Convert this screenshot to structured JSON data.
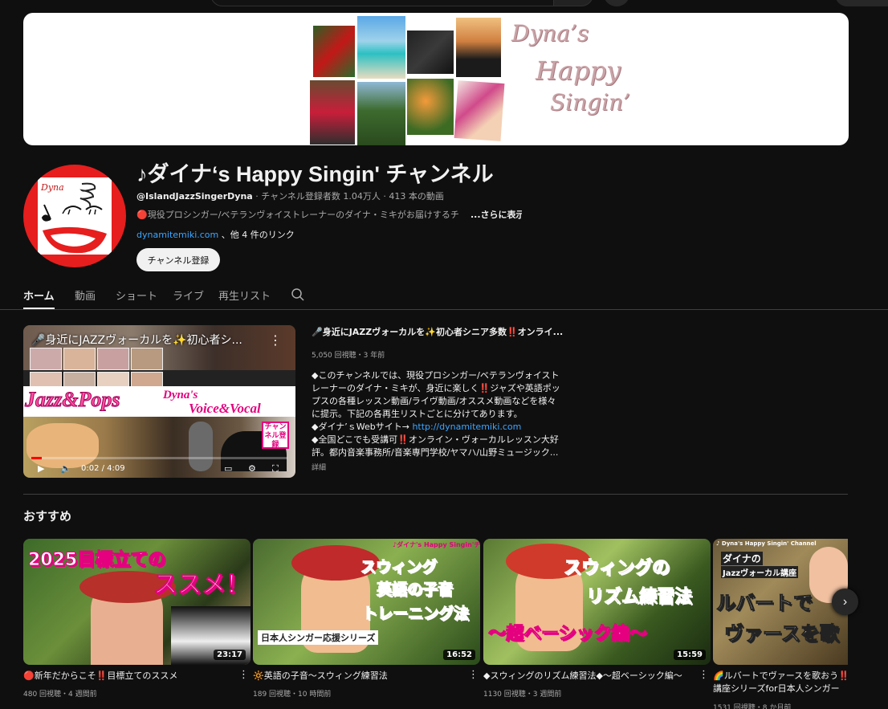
{
  "channel": {
    "title": "♪ダイナ‘s Happy Singin' チャンネル",
    "handle": "@IslandJazzSingerDyna",
    "stats": " · チャンネル登録者数 1.04万人 · 413 本の動画",
    "description": "🔴現役プロシンガー/ベテランヴォイストレーナーのダイナ・ミキがお届けするチ",
    "more_label": "...さらに表示",
    "link_text": "dynamitemiki.com",
    "link_suffix": " 、他 4 件のリンク",
    "subscribe_label": "チャンネル登録",
    "banner_title": [
      "Dyna’s",
      "Happy",
      "Singin’"
    ],
    "avatar_text": "Dyna"
  },
  "tabs": [
    {
      "label": "ホーム",
      "active": true
    },
    {
      "label": "動画",
      "active": false
    },
    {
      "label": "ショート",
      "active": false
    },
    {
      "label": "ライブ",
      "active": false
    },
    {
      "label": "再生リスト",
      "active": false
    }
  ],
  "featured": {
    "overlay_title": "🎤身近にJAZZヴォーカルを✨初心者シ...",
    "title": "🎤身近にJAZZヴォーカルを✨初心者シニア多数‼️オンライ...",
    "meta": "5,050 回視聴・3 年前",
    "desc_lines": [
      "◆このチャンネルでは、現役プロシンガー/ベテランヴォイスト",
      "レーナーのダイナ・ミキが、身近に楽しく‼️ジャズや英語ポッ",
      "プスの各種レッスン動画/ライヴ動画/オススメ動画などを様々",
      "に提示。下記の各再生リストごとに分けてあります。",
      "◆ダイナ’ｓWebサイト→ "
    ],
    "desc_link": "http://dynamitemiki.com",
    "desc_lines_2": [
      "◆全国どこでも受講可‼️オンライン・ヴォーカルレッスン大好",
      "評。都内音楽事務所/音楽専門学校/ヤマハ/山野ミュージック..."
    ],
    "more_label": "詳細",
    "thumb_jazz": "Jazz&Pops",
    "thumb_dyna": "Dyna's",
    "thumb_voice": "Voice&Vocal",
    "thumb_sticker": "チャンネル登録",
    "time": "0:02 / 4:09",
    "progress": 0.008
  },
  "recommended": {
    "section_title": "おすすめ",
    "videos": [
      {
        "title": "🔴新年だからこそ‼️目標立てのススメ",
        "meta": "480 回視聴・4 週間前",
        "duration": "23:17",
        "thumb_line1": "2025目標立ての",
        "thumb_line2": "ススメ！"
      },
      {
        "title": "🔆英語の子音〜スウィング練習法",
        "meta": "189 回視聴・10 時間前",
        "duration": "16:52",
        "thumb_line1": "スウィング",
        "thumb_line2": "英語の子音",
        "thumb_line3": "トレーニング法",
        "thumb_banner": "日本人シンガー応援シリーズ",
        "thumb_top": "♪ダイナ's Happy Singin'チャンネル"
      },
      {
        "title": "◆スウィングのリズム練習法◆〜超ベーシック編〜",
        "meta": "1130 回視聴・3 週間前",
        "duration": "15:59",
        "thumb_line1": "スウィングの",
        "thumb_line2": "リズム練習法",
        "thumb_line3": "〜超ベーシック編〜"
      },
      {
        "title": "🌈ルバートでヴァースを歌おう‼️",
        "title2": "講座シリーズfor日本人シンガー",
        "meta": "1531 回視聴・8 か月前",
        "thumb_top": "♪ Dyna's Happy Singin' Channel",
        "thumb_line1": "ダイナの",
        "thumb_line2": "Jazzヴォーカル講座",
        "thumb_line3": "ルバートで",
        "thumb_line4": "ヴァースを歌"
      }
    ]
  },
  "colors": {
    "background": "#0f0f0f",
    "text": "#f1f1f1",
    "muted": "#aaaaaa",
    "link": "#3ea6ff",
    "avatar_red": "#e61e1e",
    "progress_red": "#ff0000"
  }
}
